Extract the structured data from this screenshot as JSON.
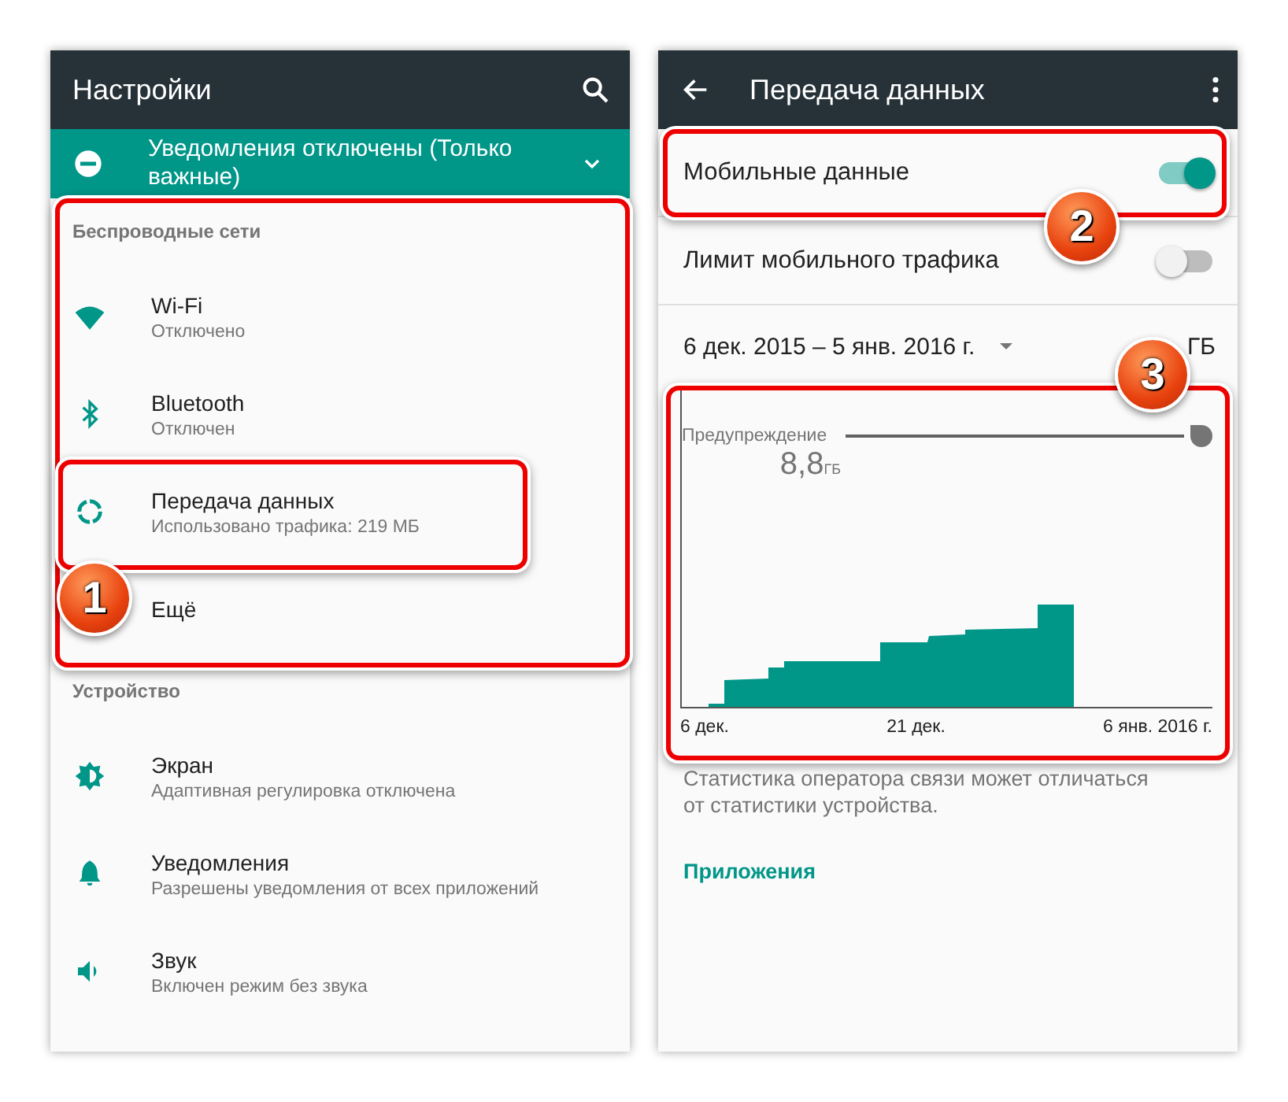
{
  "left": {
    "title": "Настройки",
    "banner": "Уведомления отключены (Только важные)",
    "sections": [
      {
        "title": "Беспроводные сети",
        "items": [
          {
            "title": "Wi-Fi",
            "subtitle": "Отключено"
          },
          {
            "title": "Bluetooth",
            "subtitle": "Отключен"
          },
          {
            "title": "Передача данных",
            "subtitle": "Использовано трафика: 219 МБ"
          },
          {
            "title": "Ещё"
          }
        ]
      },
      {
        "title": "Устройство",
        "items": [
          {
            "title": "Экран",
            "subtitle": "Адаптивная регулировка отключена"
          },
          {
            "title": "Уведомления",
            "subtitle": "Разрешены уведомления от всех приложений"
          },
          {
            "title": "Звук",
            "subtitle": "Включен режим без звука"
          }
        ]
      }
    ]
  },
  "right": {
    "title": "Передача данных",
    "switches": [
      {
        "label": "Мобильные данные",
        "on": true
      },
      {
        "label": "Лимит мобильного трафика",
        "on": false
      }
    ],
    "period": {
      "range": "6 дек. 2015 – 5 янв. 2016 г.",
      "usage": "ГБ"
    },
    "chart": {
      "warning_label": "Предупреждение",
      "warning_value": "8,8",
      "warning_unit": "ГБ",
      "x_labels": [
        "6 дек.",
        "21 дек.",
        "6 янв. 2016 г."
      ]
    },
    "note": "Статистика оператора связи может отличаться от статистики устройства.",
    "link": "Приложения"
  },
  "annotations": [
    {
      "number": "1"
    },
    {
      "number": "2"
    },
    {
      "number": "3"
    }
  ]
}
